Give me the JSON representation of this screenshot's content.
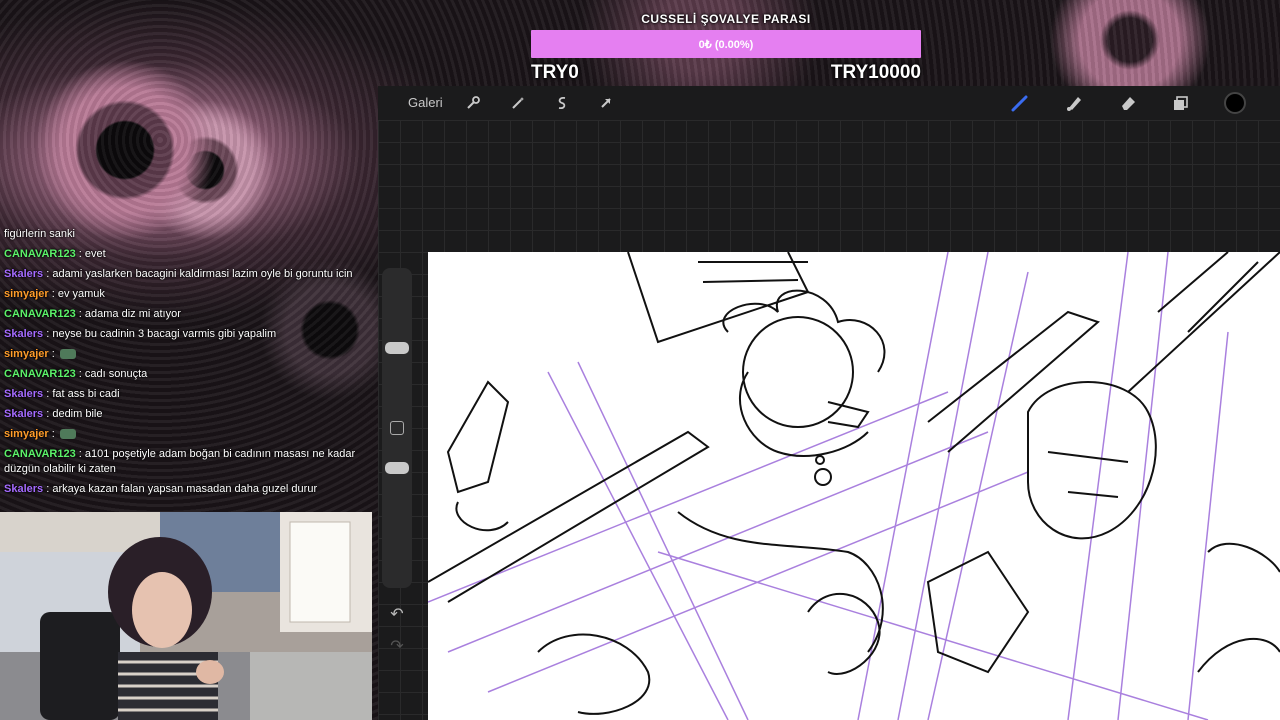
{
  "goal": {
    "title": "CUSSELİ ŞOVALYE PARASI",
    "progress_text": "0₺ (0.00%)",
    "progress_fraction": 0.0,
    "min_label": "TRY0",
    "max_label": "TRY10000",
    "bar_color": "#e57ff1"
  },
  "toolbar": {
    "gallery_label": "Galeri",
    "left_icons": [
      "wrench-icon",
      "magic-wand-icon",
      "selection-icon",
      "transform-arrow-icon"
    ],
    "right_icons": [
      "brush-icon",
      "smudge-icon",
      "eraser-icon",
      "layers-icon"
    ],
    "active_color": "#000000",
    "brush_active_color": "#3a6cf0"
  },
  "sidebar": {
    "icons": [
      "size-slider",
      "modify-square-icon",
      "opacity-slider",
      "undo-icon",
      "redo-icon"
    ],
    "undo_glyph": "↶",
    "redo_glyph": "↷"
  },
  "chat": {
    "colors": {
      "CANAVAR123": "#5cf26a",
      "Skalers": "#a56bff",
      "simyajer": "#ff9c2a"
    },
    "messages": [
      {
        "user": "",
        "text": "figürlerin sanki"
      },
      {
        "user": "CANAVAR123",
        "text": "evet"
      },
      {
        "user": "Skalers",
        "text": "adami yaslarken bacagini kaldirmasi lazim oyle bi goruntu icin"
      },
      {
        "user": "simyajer",
        "text": "ev yamuk"
      },
      {
        "user": "CANAVAR123",
        "text": "adama diz mi atıyor"
      },
      {
        "user": "Skalers",
        "text": "neyse bu cadinin 3 bacagi varmis gibi yapalim"
      },
      {
        "user": "simyajer",
        "text": ""
      },
      {
        "user": "CANAVAR123",
        "text": "cadı sonuçta"
      },
      {
        "user": "Skalers",
        "text": "fat ass bi cadi"
      },
      {
        "user": "Skalers",
        "text": "dedim bile"
      },
      {
        "user": "simyajer",
        "text": ""
      },
      {
        "user": "CANAVAR123",
        "text": "a101 poşetiyle adam boğan bi cadının masası ne kadar düzgün olabilir ki zaten"
      },
      {
        "user": "Skalers",
        "text": "arkaya kazan falan yapsan masadan daha guzel durur"
      }
    ]
  }
}
